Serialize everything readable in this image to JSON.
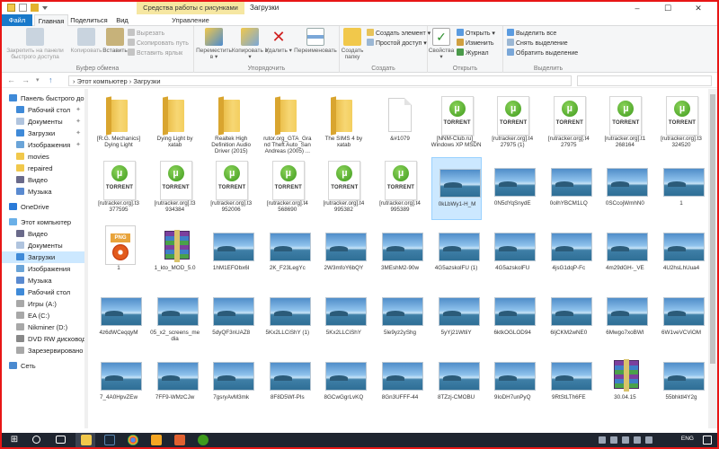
{
  "window": {
    "title": "Загрузки",
    "context_group": "Средства работы с рисунками",
    "controls": [
      "–",
      "☐",
      "✕"
    ]
  },
  "tabs": {
    "file": "Файл",
    "home": "Главная",
    "share": "Поделиться",
    "view": "Вид",
    "manage": "Управление"
  },
  "ribbon": {
    "clipboard": {
      "label": "Буфер обмена",
      "pin": "Закрепить на панели быстрого доступа",
      "copy": "Копировать",
      "paste": "Вставить",
      "cut": "Вырезать",
      "copy_path": "Скопировать путь",
      "paste_shortcut": "Вставить ярлык"
    },
    "organize": {
      "label": "Упорядочить",
      "move_to": "Переместить в ▾",
      "copy_to": "Копировать в ▾",
      "delete": "Удалить ▾",
      "rename": "Переименовать"
    },
    "new": {
      "label": "Создать",
      "new_folder": "Создать папку",
      "new_item": "Создать элемент ▾",
      "easy_access": "Простой доступ ▾"
    },
    "open": {
      "label": "Открыть",
      "properties": "Свойства ▾",
      "open": "Открыть ▾",
      "edit": "Изменить",
      "history": "Журнал"
    },
    "select": {
      "label": "Выделить",
      "select_all": "Выделить все",
      "select_none": "Снять выделение",
      "invert": "Обратить выделение"
    }
  },
  "address": {
    "path": "›  Этот компьютер  ›  Загрузки"
  },
  "nav": [
    {
      "label": "Панель быстрого до",
      "type": "star",
      "indent": 0,
      "pin": false,
      "selected": false
    },
    {
      "label": "Рабочий стол",
      "type": "desktop",
      "indent": 1,
      "pin": true,
      "selected": false
    },
    {
      "label": "Документы",
      "type": "docs",
      "indent": 1,
      "pin": true,
      "selected": false
    },
    {
      "label": "Загрузки",
      "type": "down",
      "indent": 1,
      "pin": true,
      "selected": false
    },
    {
      "label": "Изображения",
      "type": "pics",
      "indent": 1,
      "pin": true,
      "selected": false
    },
    {
      "label": "movies",
      "type": "folder",
      "indent": 1,
      "pin": false,
      "selected": false
    },
    {
      "label": "repaired",
      "type": "folder",
      "indent": 1,
      "pin": false,
      "selected": false
    },
    {
      "label": "Видео",
      "type": "video",
      "indent": 1,
      "pin": false,
      "selected": false
    },
    {
      "label": "Музыка",
      "type": "music",
      "indent": 1,
      "pin": false,
      "selected": false
    },
    {
      "label": "",
      "type": "gap",
      "indent": 0,
      "pin": false,
      "selected": false
    },
    {
      "label": "OneDrive",
      "type": "cloud",
      "indent": 0,
      "pin": false,
      "selected": false
    },
    {
      "label": "",
      "type": "gap",
      "indent": 0,
      "pin": false,
      "selected": false
    },
    {
      "label": "Этот компьютер",
      "type": "pc",
      "indent": 0,
      "pin": false,
      "selected": false
    },
    {
      "label": "Видео",
      "type": "video",
      "indent": 1,
      "pin": false,
      "selected": false
    },
    {
      "label": "Документы",
      "type": "docs",
      "indent": 1,
      "pin": false,
      "selected": false
    },
    {
      "label": "Загрузки",
      "type": "down",
      "indent": 1,
      "pin": false,
      "selected": true
    },
    {
      "label": "Изображения",
      "type": "pics",
      "indent": 1,
      "pin": false,
      "selected": false
    },
    {
      "label": "Музыка",
      "type": "music",
      "indent": 1,
      "pin": false,
      "selected": false
    },
    {
      "label": "Рабочий стол",
      "type": "desktop",
      "indent": 1,
      "pin": false,
      "selected": false
    },
    {
      "label": "Игры (A:)",
      "type": "drive",
      "indent": 1,
      "pin": false,
      "selected": false
    },
    {
      "label": "EA (C:)",
      "type": "drive",
      "indent": 1,
      "pin": false,
      "selected": false
    },
    {
      "label": "Nikminer (D:)",
      "type": "drive",
      "indent": 1,
      "pin": false,
      "selected": false
    },
    {
      "label": "DVD RW дисковод (",
      "type": "dvd",
      "indent": 1,
      "pin": false,
      "selected": false
    },
    {
      "label": "Зарезервировано с",
      "type": "drive",
      "indent": 1,
      "pin": false,
      "selected": false
    },
    {
      "label": "",
      "type": "gap",
      "indent": 0,
      "pin": false,
      "selected": false
    },
    {
      "label": "Сеть",
      "type": "net",
      "indent": 0,
      "pin": false,
      "selected": false
    }
  ],
  "files": [
    {
      "name": "[R.G. Mechanics] Dying Light",
      "type": "folder"
    },
    {
      "name": "Dying Light by xatab",
      "type": "folder"
    },
    {
      "name": "Realtek High Definition Audio Driver (2015)",
      "type": "folder"
    },
    {
      "name": "rutor.org_GTA_Grand Theft Auto_San Andreas (2005) ...",
      "type": "folder"
    },
    {
      "name": "The SIMS 4 by xatab",
      "type": "folder"
    },
    {
      "name": "&#1079",
      "type": "doc"
    },
    {
      "name": "[NNM-Club.ru]_ Windows XP MSDN",
      "type": "torrent"
    },
    {
      "name": "[rutracker.org].t4 27975 (1)",
      "type": "torrent"
    },
    {
      "name": "[rutracker.org].t4 27975",
      "type": "torrent"
    },
    {
      "name": "[rutracker.org].t1 268164",
      "type": "torrent"
    },
    {
      "name": "[rutracker.org].t3 324520",
      "type": "torrent"
    },
    {
      "name": "[rutracker.org].t3 377595",
      "type": "torrent"
    },
    {
      "name": "[rutracker.org].t3 934384",
      "type": "torrent"
    },
    {
      "name": "[rutracker.org].t3 952006",
      "type": "torrent"
    },
    {
      "name": "[rutracker.org].t4 568690",
      "type": "torrent"
    },
    {
      "name": "[rutracker.org].t4 995382",
      "type": "torrent"
    },
    {
      "name": "[rutracker.org].t4 995389",
      "type": "torrent"
    },
    {
      "name": "0kLbWy1-H_M",
      "type": "image",
      "selected": true
    },
    {
      "name": "0N5dYqSnydE",
      "type": "image"
    },
    {
      "name": "0olhYBCM1LQ",
      "type": "image"
    },
    {
      "name": "0SCcojWmhN0",
      "type": "image"
    },
    {
      "name": "1",
      "type": "image"
    },
    {
      "name": "1",
      "type": "png"
    },
    {
      "name": "1_kto_MOD_5.0",
      "type": "rar"
    },
    {
      "name": "1hM1EFObx6I",
      "type": "image"
    },
    {
      "name": "2K_F23LegYc",
      "type": "image"
    },
    {
      "name": "2W3mfoY6bQY",
      "type": "image"
    },
    {
      "name": "3MEshM2-90w",
      "type": "image"
    },
    {
      "name": "4G5azskolFU (1)",
      "type": "image"
    },
    {
      "name": "4G5azskolFU",
      "type": "image"
    },
    {
      "name": "4jsG1dqP-Fc",
      "type": "image"
    },
    {
      "name": "4m29dGH-_VE",
      "type": "image"
    },
    {
      "name": "4U2hsLhUua4",
      "type": "image"
    },
    {
      "name": "4z6dWCeqqyM",
      "type": "image"
    },
    {
      "name": "05_x2_screens_media",
      "type": "image"
    },
    {
      "name": "5dyQF3nUAZ8",
      "type": "image"
    },
    {
      "name": "5Kx2LLCiShY (1)",
      "type": "image"
    },
    {
      "name": "5Kx2LLCiShY",
      "type": "image"
    },
    {
      "name": "5le9yz2yShg",
      "type": "image"
    },
    {
      "name": "5yYj21WtliY",
      "type": "image"
    },
    {
      "name": "6ktkOGLOD94",
      "type": "image"
    },
    {
      "name": "6IjCKM2wNE0",
      "type": "image"
    },
    {
      "name": "6Mwgo7xoBWI",
      "type": "image"
    },
    {
      "name": "6W1veVCViOM",
      "type": "image"
    },
    {
      "name": "7_4A0HpvZEw",
      "type": "image"
    },
    {
      "name": "7FF9-WMzCJw",
      "type": "image"
    },
    {
      "name": "7gsryAvM3mk",
      "type": "image"
    },
    {
      "name": "8F8D5Wf-PIs",
      "type": "image"
    },
    {
      "name": "8GCwGgrLvKQ",
      "type": "image"
    },
    {
      "name": "8Gn3UFFF-44",
      "type": "image"
    },
    {
      "name": "8TZzj-CMOBU",
      "type": "image"
    },
    {
      "name": "9IoDH7unPyQ",
      "type": "image"
    },
    {
      "name": "9RtStLTh6FE",
      "type": "image"
    },
    {
      "name": "30.04.15",
      "type": "rar"
    },
    {
      "name": "55bhktl4Y2g",
      "type": "image"
    }
  ],
  "icons": {
    "torrent_word": "TORRENT",
    "torrent_glyph": "µ",
    "png_word": "PNG"
  },
  "taskbar": {
    "lang": "ENG"
  }
}
